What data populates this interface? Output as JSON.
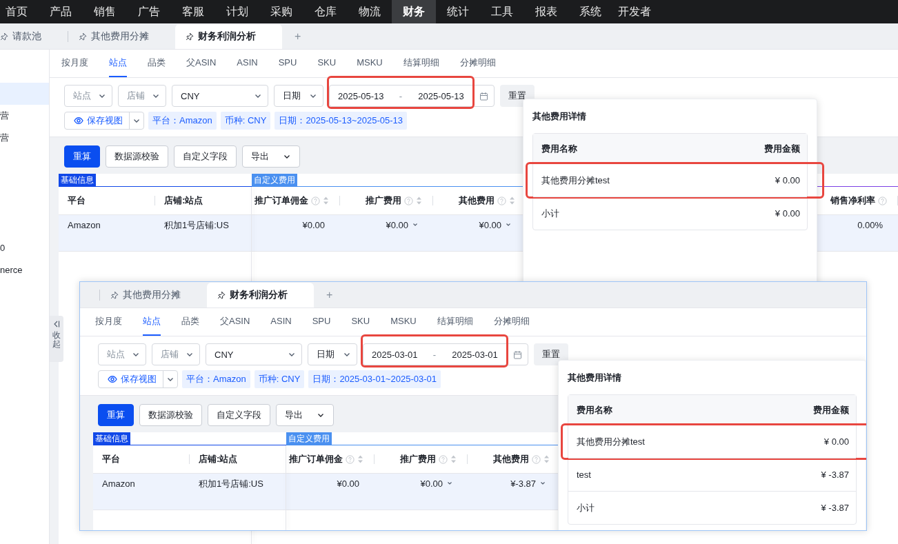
{
  "top_nav": [
    {
      "label": "首页",
      "selected": false
    },
    {
      "label": "产品",
      "selected": false
    },
    {
      "label": "销售",
      "selected": false
    },
    {
      "label": "广告",
      "selected": false
    },
    {
      "label": "客服",
      "selected": false
    },
    {
      "label": "计划",
      "selected": false
    },
    {
      "label": "采购",
      "selected": false
    },
    {
      "label": "仓库",
      "selected": false
    },
    {
      "label": "物流",
      "selected": false
    },
    {
      "label": "财务",
      "selected": true
    },
    {
      "label": "统计",
      "selected": false
    },
    {
      "label": "工具",
      "selected": false
    },
    {
      "label": "报表",
      "selected": false
    },
    {
      "label": "系统",
      "selected": false
    },
    {
      "label": "开发者",
      "selected": false
    }
  ],
  "page_tabs": [
    {
      "label": "请款池",
      "selected": false
    },
    {
      "label": "其他费用分摊",
      "selected": false
    },
    {
      "label": "财务利润分析",
      "selected": true
    }
  ],
  "add_tab": "+",
  "sidebar": {
    "items": [
      {
        "selected": true
      },
      {
        "label": "营",
        "selected": false
      },
      {
        "label": "营",
        "selected": false
      },
      {
        "label": "0",
        "selected": false
      },
      {
        "label": "nerce",
        "selected": false
      }
    ],
    "collapse_button": {
      "label": "收起"
    }
  },
  "main": {
    "view_tabs": [
      {
        "label": "按月度",
        "selected": false
      },
      {
        "label": "站点",
        "selected": true
      },
      {
        "label": "品类",
        "selected": false
      },
      {
        "label": "父ASIN",
        "selected": false
      },
      {
        "label": "ASIN",
        "selected": false
      },
      {
        "label": "SPU",
        "selected": false
      },
      {
        "label": "SKU",
        "selected": false
      },
      {
        "label": "MSKU",
        "selected": false
      },
      {
        "label": "结算明细",
        "selected": false
      },
      {
        "label": "分摊明细",
        "selected": false
      }
    ],
    "filters": {
      "selects": [
        {
          "placeholder": "站点"
        },
        {
          "placeholder": "店铺"
        },
        {
          "value": "CNY"
        },
        {
          "value": "日期"
        }
      ],
      "date_range": {
        "start": "2025-05-13",
        "separator": "-",
        "end": "2025-05-13",
        "highlighted": true
      },
      "reset_button": "重置"
    },
    "save_view_button": "保存视图",
    "tags": [
      "平台：Amazon",
      "币种: CNY",
      "日期：2025-05-13~2025-05-13"
    ],
    "toolbar": [
      {
        "label": "重算",
        "kind": "primary"
      },
      {
        "label": "数据源校验",
        "kind": "default"
      },
      {
        "label": "自定义字段",
        "kind": "default"
      },
      {
        "label": "导出",
        "kind": "dropdown"
      }
    ],
    "table": {
      "groups": [
        {
          "label": "基础信息",
          "color": "#1148e8",
          "columns": [
            {
              "label": "平台",
              "kind": "text"
            },
            {
              "label": "店铺:站点",
              "kind": "text"
            }
          ]
        },
        {
          "label": "自定义费用",
          "color": "#4a90f0",
          "columns": [
            {
              "label": "推广订单佣金",
              "kind": "sortable"
            },
            {
              "label": "推广费用",
              "kind": "sortable"
            },
            {
              "label": "其他费用",
              "kind": "sortable"
            }
          ]
        },
        {
          "color": "#7b3fe4",
          "columns": [
            {
              "label": "销售净利率",
              "kind": "help"
            }
          ]
        }
      ],
      "rows": [
        {
          "selected": true,
          "cells": [
            {
              "text": "Amazon",
              "expandable": false
            },
            {
              "text": "积加1号店铺:US",
              "expandable": false
            },
            {
              "text": "¥0.00",
              "expandable": false
            },
            {
              "text": "¥0.00",
              "expandable": true
            },
            {
              "text": "¥0.00",
              "expandable": true
            },
            {
              "text": "0.00%",
              "expandable": false
            }
          ]
        }
      ]
    },
    "popup": {
      "title": "其他费用详情",
      "columns": [
        "费用名称",
        "费用金额"
      ],
      "rows": [
        {
          "name": "其他费用分摊test",
          "amount": "¥ 0.00",
          "highlighted": true
        },
        {
          "name": "小计",
          "amount": "¥ 0.00",
          "highlighted": false
        }
      ]
    }
  },
  "overlay": {
    "page_tabs": [
      {
        "label": "其他费用分摊",
        "selected": false
      },
      {
        "label": "财务利润分析",
        "selected": true
      }
    ],
    "add_tab": "+",
    "view_tabs": [
      {
        "label": "按月度",
        "selected": false
      },
      {
        "label": "站点",
        "selected": true
      },
      {
        "label": "品类",
        "selected": false
      },
      {
        "label": "父ASIN",
        "selected": false
      },
      {
        "label": "ASIN",
        "selected": false
      },
      {
        "label": "SPU",
        "selected": false
      },
      {
        "label": "SKU",
        "selected": false
      },
      {
        "label": "MSKU",
        "selected": false
      },
      {
        "label": "结算明细",
        "selected": false
      },
      {
        "label": "分摊明细",
        "selected": false
      }
    ],
    "filters": {
      "selects": [
        {
          "placeholder": "站点"
        },
        {
          "placeholder": "店铺"
        },
        {
          "value": "CNY"
        },
        {
          "value": "日期"
        }
      ],
      "date_range": {
        "start": "2025-03-01",
        "separator": "-",
        "end": "2025-03-01",
        "highlighted": true
      },
      "reset_button": "重置"
    },
    "save_view_button": "保存视图",
    "tags": [
      "平台：Amazon",
      "币种: CNY",
      "日期：2025-03-01~2025-03-01"
    ],
    "toolbar": [
      {
        "label": "重算",
        "kind": "primary"
      },
      {
        "label": "数据源校验",
        "kind": "default"
      },
      {
        "label": "自定义字段",
        "kind": "default"
      },
      {
        "label": "导出",
        "kind": "dropdown"
      }
    ],
    "table": {
      "groups": [
        {
          "label": "基础信息",
          "color": "#1148e8",
          "columns": [
            {
              "label": "平台",
              "kind": "text"
            },
            {
              "label": "店铺:站点",
              "kind": "text"
            }
          ]
        },
        {
          "label": "自定义费用",
          "color": "#4a90f0",
          "columns": [
            {
              "label": "推广订单佣金",
              "kind": "sortable"
            },
            {
              "label": "推广费用",
              "kind": "sortable"
            },
            {
              "label": "其他费用",
              "kind": "sortable"
            }
          ]
        }
      ],
      "rows": [
        {
          "selected": true,
          "cells": [
            {
              "text": "Amazon",
              "expandable": false
            },
            {
              "text": "积加1号店铺:US",
              "expandable": false
            },
            {
              "text": "¥0.00",
              "expandable": false
            },
            {
              "text": "¥0.00",
              "expandable": true
            },
            {
              "text": "¥-3.87",
              "expandable": true
            }
          ]
        }
      ]
    },
    "popup": {
      "title": "其他费用详情",
      "columns": [
        "费用名称",
        "费用金额"
      ],
      "rows": [
        {
          "name": "其他费用分摊test",
          "amount": "¥ 0.00",
          "highlighted": true
        },
        {
          "name": "test",
          "amount": "¥ -3.87",
          "highlighted": false
        },
        {
          "name": "小计",
          "amount": "¥ -3.87",
          "highlighted": false
        }
      ]
    }
  }
}
